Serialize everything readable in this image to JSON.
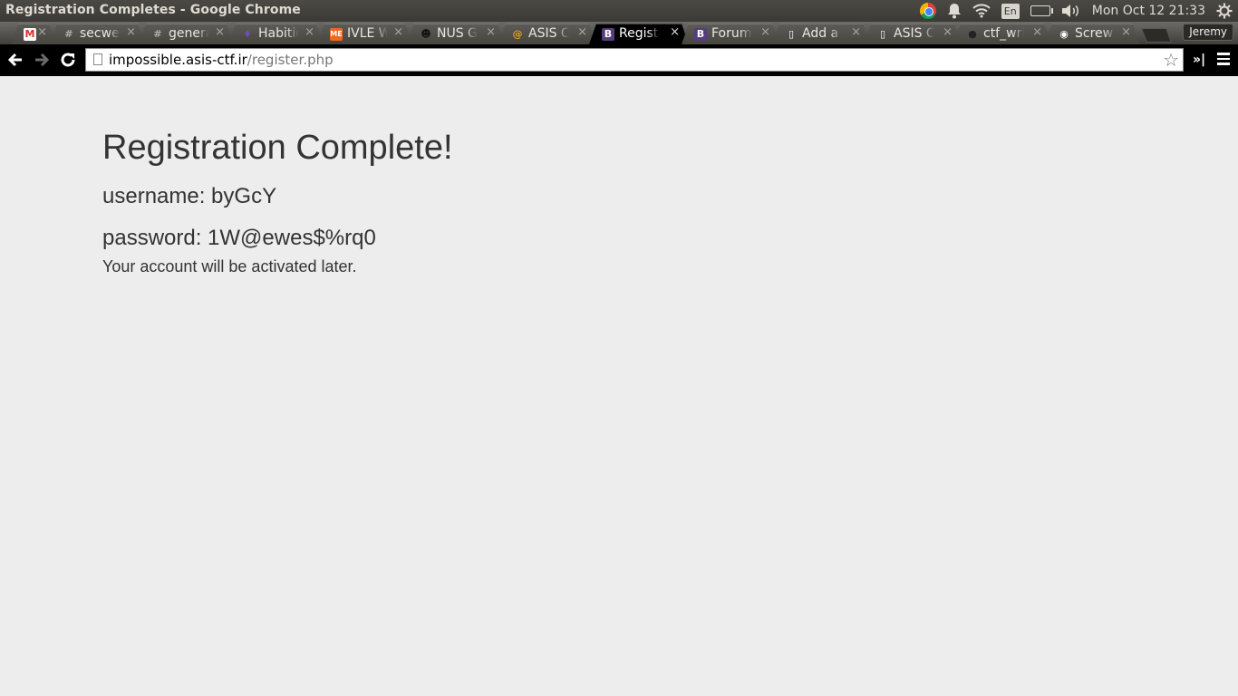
{
  "os_bar": {
    "window_title": "Registration Completes - Google Chrome",
    "language": "En",
    "clock": "Mon Oct 12 21:33"
  },
  "tabs": [
    {
      "label": "",
      "favicon": "gmail-icon",
      "fav_char": "M",
      "fav_color": "#d93025",
      "active": false
    },
    {
      "label": "secwee",
      "favicon": "hash-icon",
      "fav_char": "#",
      "fav_color": "#b0aea8",
      "active": false
    },
    {
      "label": "genera",
      "favicon": "hash-icon",
      "fav_char": "#",
      "fav_color": "#b0aea8",
      "active": false
    },
    {
      "label": "Habitic",
      "favicon": "habitica-icon",
      "fav_char": "♦",
      "fav_color": "#6e4fb5",
      "active": false
    },
    {
      "label": "IVLE W",
      "favicon": "ivle-icon",
      "fav_char": "ME",
      "fav_color": "#f26522",
      "active": false
    },
    {
      "label": "NUS Gr",
      "favicon": "owl-icon",
      "fav_char": "☻",
      "fav_color": "#111111",
      "active": false
    },
    {
      "label": "ASIS Cy",
      "favicon": "at-sign-icon",
      "fav_char": "@",
      "fav_color": "#e0a020",
      "active": false
    },
    {
      "label": "Registr",
      "favicon": "bootstrap-icon",
      "fav_char": "B",
      "fav_color": "#563d7c",
      "active": true
    },
    {
      "label": "Forum",
      "favicon": "bootstrap-icon",
      "fav_char": "B",
      "fav_color": "#563d7c",
      "active": false
    },
    {
      "label": "Add a N",
      "favicon": "document-icon",
      "fav_char": "▯",
      "fav_color": "#ffffff",
      "active": false
    },
    {
      "label": "ASIS C",
      "favicon": "document-icon",
      "fav_char": "▯",
      "fav_color": "#ffffff",
      "active": false
    },
    {
      "label": "ctf_wri",
      "favicon": "github-icon",
      "fav_char": "●",
      "fav_color": "#222222",
      "active": false
    },
    {
      "label": "Screw",
      "favicon": "reddit-icon",
      "fav_char": "◉",
      "fav_color": "#ffffff",
      "active": false
    }
  ],
  "profile": {
    "name": "Jeremy"
  },
  "omnibox": {
    "url_host": "impossible.asis-ctf.ir",
    "url_path": "/register.php"
  },
  "page": {
    "heading": "Registration Complete!",
    "username_line": "username: byGcY",
    "password_line": "password: 1W@ewes$%rq0",
    "note": "Your account will be activated later."
  }
}
